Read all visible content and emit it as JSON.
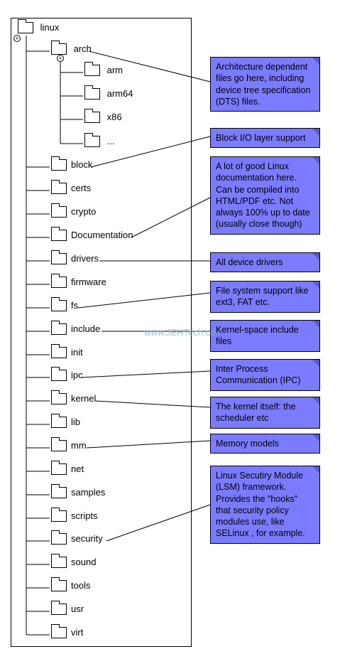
{
  "tree": {
    "root": "linux",
    "arch": "arch",
    "arch_children": {
      "arm": "arm",
      "arm64": "arm64",
      "x86": "x86",
      "more": "..."
    },
    "block": "block",
    "certs": "certs",
    "crypto": "crypto",
    "documentation": "Documentation",
    "drivers": "drivers",
    "firmware": "firmware",
    "fs": "fs",
    "include": "include",
    "init": "init",
    "ipc": "ipc",
    "kernel": "kernel",
    "lib": "lib",
    "mm": "mm",
    "net": "net",
    "samples": "samples",
    "scripts": "scripts",
    "security": "security",
    "sound": "sound",
    "tools": "tools",
    "usr": "usr",
    "virt": "virt"
  },
  "notes": {
    "arch": "Architecture dependent files go here, including device tree specification (DTS) files.",
    "block": "Block I/O layer support",
    "documentation": "A lot of good Linux documentation here. Can be compiled into HTML/PDF etc. Not always 100% up to date (usually close though)",
    "drivers": "All device drivers",
    "fs": "File system support like ext3, FAT etc.",
    "include": "Kernel-space include files",
    "ipc": "Inter Process Communication (IPC)",
    "kernel": "The kernel itself: the scheduler etc",
    "mm": "Memory models",
    "security": "Linux Secutiry Module (LSM) framework. Provides the \"hooks\" that security policy modules use, like SELinux , for example."
  },
  "watermark": "www.JEHTech.co"
}
